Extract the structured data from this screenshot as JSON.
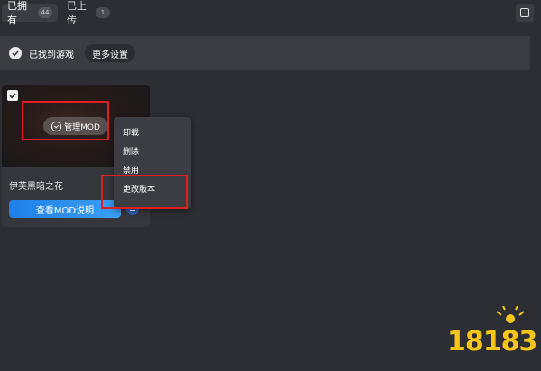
{
  "tabs": [
    {
      "label": "已拥有",
      "badge": "44"
    },
    {
      "label": "已上传",
      "badge": "1"
    }
  ],
  "gamebar": {
    "found_label": "已找到游戏",
    "more_settings_label": "更多设置"
  },
  "card": {
    "manage_label": "管理MOD",
    "title": "伊芙黑暗之花",
    "view_button_label": "查看MOD说明"
  },
  "context_menu": {
    "items": [
      "卸载",
      "删除",
      "禁用",
      "更改版本"
    ]
  },
  "watermark": {
    "text": "18183"
  },
  "colors": {
    "background": "#2c2e33",
    "panel": "#3a3c42",
    "accent_blue": "#1f7fe8",
    "highlight_red": "#e02020",
    "logo_yellow": "#f5c518"
  },
  "icons": [
    "checkmark-icon",
    "window-icon",
    "check-circle-icon",
    "more-icon"
  ]
}
